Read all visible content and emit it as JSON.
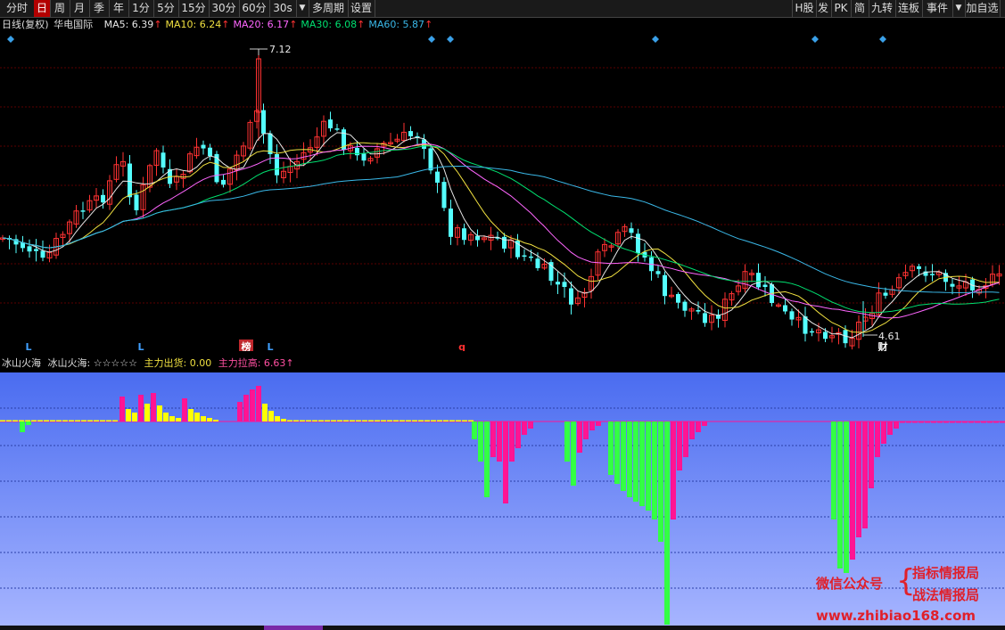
{
  "toolbar": {
    "left_tabs": [
      "分时",
      "日",
      "周",
      "月",
      "季",
      "年",
      "1分",
      "5分",
      "15分",
      "30分",
      "60分",
      "30s"
    ],
    "active_tab": "日",
    "dropdown_glyph": "▼",
    "multi_period_label": "多周期",
    "settings_label": "设置",
    "right_tabs": [
      "H股",
      "发",
      "PK",
      "简",
      "九转",
      "连板",
      "事件"
    ],
    "add_watch_label": "加自选"
  },
  "chart_header": {
    "title": "日线(复权)",
    "stock_name": "华电国际",
    "ma": [
      {
        "label": "MA5: 6.39",
        "color": "#e8e8e8"
      },
      {
        "label": "MA10: 6.24",
        "color": "#f0e040"
      },
      {
        "label": "MA20: 6.17",
        "color": "#ff66ff"
      },
      {
        "label": "MA30: 6.08",
        "color": "#00e070"
      },
      {
        "label": "MA60: 5.87",
        "color": "#3ab8e8"
      }
    ],
    "arrow": "↑"
  },
  "annotations": {
    "high_price": "7.12",
    "low_price": "4.61",
    "bottom_markers": [
      {
        "text": "L",
        "color": "#40a0ff"
      },
      {
        "text": "L",
        "color": "#40a0ff"
      },
      {
        "text": "榜",
        "color": "#ffffff"
      },
      {
        "text": "L",
        "color": "#40a0ff"
      },
      {
        "text": "q",
        "color": "#ff3030"
      },
      {
        "text": "财",
        "color": "#ffffff"
      }
    ]
  },
  "indicator_header": {
    "name": "冰山火海",
    "stars_label": "冰山火海: ☆☆☆☆☆",
    "out_label": "主力出货: 0.00",
    "up_label": "主力拉高: 6.63",
    "arrow": "↑"
  },
  "watermark": {
    "wechat_label": "微信公众号",
    "brace": "{",
    "name1": "指标情报局",
    "name2": "战法情报局",
    "url": "www.zhibiao168.com"
  },
  "colors": {
    "up": "#ff3232",
    "down": "#54ffff",
    "fire": "#ff1493",
    "fire_small": "#ffff00",
    "ice": "#33ff44",
    "ice_top": "#ff1493",
    "indicator_bg_top": "#4a6cf0",
    "indicator_bg_bottom": "#a8b6ff"
  },
  "chart_data": {
    "type": "candlestick",
    "title": "华电国际 日线(复权)",
    "price_marks": {
      "high": 7.12,
      "low": 4.61
    },
    "ma_last": {
      "MA5": 6.39,
      "MA10": 6.24,
      "MA20": 6.17,
      "MA30": 6.08,
      "MA60": 5.87
    },
    "indicator": {
      "name": "冰山火海",
      "main_out": 0.0,
      "main_up": 6.63
    }
  }
}
